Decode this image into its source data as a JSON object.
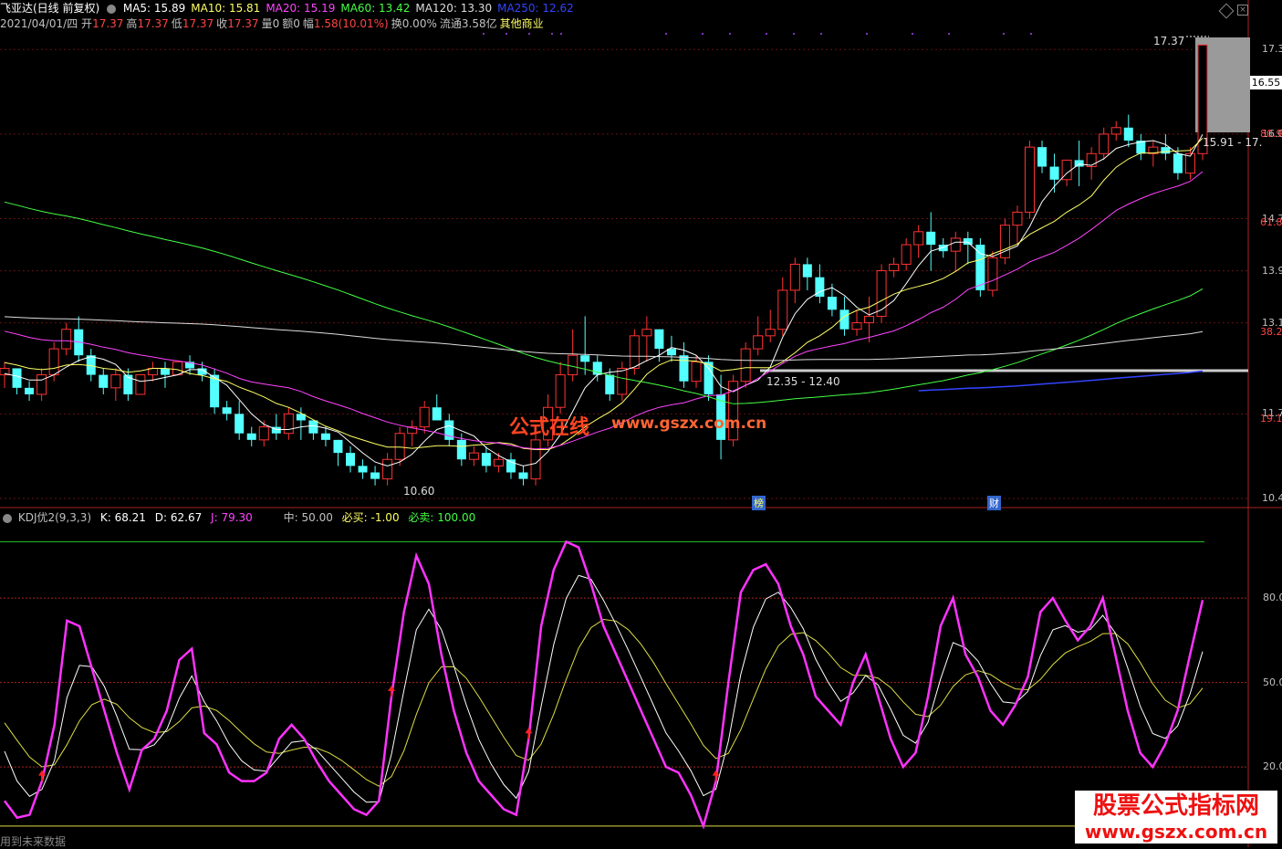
{
  "header": {
    "stock_name": "飞亚达(日线 前复权)",
    "ma": [
      {
        "label": "MA5: 15.89",
        "color": "#ffffff"
      },
      {
        "label": "MA10: 15.81",
        "color": "#ffff66"
      },
      {
        "label": "MA20: 15.19",
        "color": "#ff44ff"
      },
      {
        "label": "MA60: 13.42",
        "color": "#44ff44"
      },
      {
        "label": "MA120: 13.30",
        "color": "#dddddd"
      },
      {
        "label": "MA250: 12.62",
        "color": "#3344ff"
      }
    ],
    "date": "2021/04/01/四",
    "quote": [
      {
        "label": "开",
        "value": "17.37",
        "color": "#ff4444"
      },
      {
        "label": "高",
        "value": "17.37",
        "color": "#ff4444"
      },
      {
        "label": "低",
        "value": "17.37",
        "color": "#ff4444"
      },
      {
        "label": "收",
        "value": "17.37",
        "color": "#ff4444"
      },
      {
        "label": "量",
        "value": "0",
        "color": "#c0c0c0"
      },
      {
        "label": "额",
        "value": "0",
        "color": "#c0c0c0"
      },
      {
        "label": "幅",
        "value": "1.58(10.01%)",
        "color": "#ff4444"
      },
      {
        "label": "换",
        "value": "0.00%",
        "color": "#c0c0c0"
      },
      {
        "label": "流通",
        "value": "3.58亿",
        "color": "#c0c0c0"
      },
      {
        "label": "",
        "value": "其他商业",
        "color": "#ffff66"
      }
    ]
  },
  "price_axis_ticks": [
    "17.3",
    "16.0",
    "14.7",
    "13.9",
    "13.1",
    "11.7",
    "10.4"
  ],
  "right_pct_labels": [
    "80.9",
    "61.8",
    "38.2",
    "19.1"
  ],
  "last_price_box": "16.55",
  "annotations": {
    "high_label": "17.37",
    "low_label": "10.60",
    "range_label_1": "12.35 - 12.40",
    "range_label_2": "15.91 - 17.",
    "marker_1": "榜",
    "marker_2": "财"
  },
  "watermark": {
    "cn": "公式在线",
    "url": "www.gszx.com.cn"
  },
  "brand": {
    "line1": "股票公式指标网",
    "line2": "www.gszx.com.cn"
  },
  "indicator": {
    "name": "KDJ优2(9,3,3)",
    "k_label": "K: 68.21",
    "d_label": "D: 62.67",
    "j_label": "J: 79.30",
    "mid_label": "中: 50.00",
    "buy_label": "必买: -1.00",
    "sell_label": "必卖: 100.00",
    "axis_ticks": [
      "80.00",
      "50.00",
      "20.00"
    ]
  },
  "footer_note": "用到未来数据",
  "chart_data": {
    "type": "candlestick",
    "price_range": [
      10.4,
      17.5
    ],
    "candles": [
      [
        12.3,
        12.5,
        12.1,
        12.4
      ],
      [
        12.4,
        12.4,
        12.0,
        12.1
      ],
      [
        12.1,
        12.2,
        11.9,
        12.0
      ],
      [
        12.0,
        12.4,
        11.9,
        12.3
      ],
      [
        12.3,
        12.8,
        12.2,
        12.7
      ],
      [
        12.7,
        13.1,
        12.6,
        13.0
      ],
      [
        13.0,
        13.2,
        12.5,
        12.6
      ],
      [
        12.6,
        12.7,
        12.2,
        12.3
      ],
      [
        12.3,
        12.4,
        12.0,
        12.1
      ],
      [
        12.1,
        12.4,
        11.9,
        12.3
      ],
      [
        12.3,
        12.4,
        11.9,
        12.0
      ],
      [
        12.0,
        12.3,
        12.0,
        12.3
      ],
      [
        12.3,
        12.5,
        12.2,
        12.4
      ],
      [
        12.4,
        12.5,
        12.1,
        12.3
      ],
      [
        12.3,
        12.5,
        12.3,
        12.5
      ],
      [
        12.5,
        12.6,
        12.3,
        12.4
      ],
      [
        12.4,
        12.5,
        12.2,
        12.3
      ],
      [
        12.3,
        12.4,
        11.7,
        11.8
      ],
      [
        11.8,
        11.9,
        11.6,
        11.7
      ],
      [
        11.7,
        11.9,
        11.3,
        11.4
      ],
      [
        11.4,
        11.5,
        11.2,
        11.3
      ],
      [
        11.3,
        11.6,
        11.2,
        11.5
      ],
      [
        11.5,
        11.7,
        11.3,
        11.4
      ],
      [
        11.4,
        11.8,
        11.3,
        11.7
      ],
      [
        11.7,
        11.8,
        11.3,
        11.6
      ],
      [
        11.6,
        11.6,
        11.3,
        11.4
      ],
      [
        11.4,
        11.5,
        11.2,
        11.3
      ],
      [
        11.3,
        11.3,
        10.9,
        11.1
      ],
      [
        11.1,
        11.2,
        10.8,
        10.9
      ],
      [
        10.9,
        11.0,
        10.7,
        10.8
      ],
      [
        10.8,
        10.9,
        10.6,
        10.7
      ],
      [
        10.7,
        11.1,
        10.6,
        11.0
      ],
      [
        11.0,
        11.5,
        10.9,
        11.4
      ],
      [
        11.4,
        11.6,
        11.2,
        11.5
      ],
      [
        11.5,
        11.9,
        11.4,
        11.8
      ],
      [
        11.8,
        12.0,
        11.6,
        11.6
      ],
      [
        11.6,
        11.7,
        11.2,
        11.3
      ],
      [
        11.3,
        11.4,
        10.9,
        11.0
      ],
      [
        11.0,
        11.2,
        10.9,
        11.1
      ],
      [
        11.1,
        11.2,
        10.8,
        10.9
      ],
      [
        10.9,
        11.1,
        10.8,
        11.0
      ],
      [
        11.0,
        11.1,
        10.7,
        10.8
      ],
      [
        10.8,
        10.9,
        10.6,
        10.7
      ],
      [
        10.7,
        11.5,
        10.6,
        11.3
      ],
      [
        11.3,
        12.0,
        11.2,
        11.8
      ],
      [
        11.8,
        12.5,
        11.7,
        12.3
      ],
      [
        12.3,
        13.0,
        12.2,
        12.6
      ],
      [
        12.6,
        13.2,
        12.3,
        12.5
      ],
      [
        12.5,
        12.6,
        12.2,
        12.3
      ],
      [
        12.3,
        12.4,
        11.9,
        12.0
      ],
      [
        12.0,
        12.5,
        11.9,
        12.4
      ],
      [
        12.4,
        13.0,
        12.3,
        12.9
      ],
      [
        12.9,
        13.2,
        12.5,
        13.0
      ],
      [
        13.0,
        13.0,
        12.5,
        12.7
      ],
      [
        12.7,
        12.9,
        12.5,
        12.6
      ],
      [
        12.6,
        12.8,
        12.1,
        12.2
      ],
      [
        12.2,
        12.6,
        12.1,
        12.5
      ],
      [
        12.5,
        12.6,
        11.9,
        12.0
      ],
      [
        12.0,
        12.3,
        11.0,
        11.3
      ],
      [
        11.3,
        12.3,
        11.2,
        12.2
      ],
      [
        12.2,
        12.8,
        12.1,
        12.7
      ],
      [
        12.7,
        13.2,
        12.6,
        12.9
      ],
      [
        12.9,
        13.3,
        12.8,
        13.0
      ],
      [
        13.0,
        13.8,
        12.9,
        13.6
      ],
      [
        13.6,
        14.1,
        13.4,
        14.0
      ],
      [
        14.0,
        14.1,
        13.6,
        13.8
      ],
      [
        13.8,
        14.0,
        13.4,
        13.5
      ],
      [
        13.5,
        13.7,
        13.2,
        13.3
      ],
      [
        13.3,
        13.5,
        12.9,
        13.0
      ],
      [
        13.0,
        13.3,
        12.9,
        13.1
      ],
      [
        13.1,
        13.5,
        12.8,
        13.2
      ],
      [
        13.2,
        14.0,
        13.1,
        13.9
      ],
      [
        13.9,
        14.1,
        13.8,
        14.0
      ],
      [
        14.0,
        14.4,
        13.9,
        14.3
      ],
      [
        14.3,
        14.6,
        14.1,
        14.5
      ],
      [
        14.5,
        14.8,
        13.9,
        14.3
      ],
      [
        14.3,
        14.4,
        14.1,
        14.2
      ],
      [
        14.2,
        14.5,
        13.9,
        14.4
      ],
      [
        14.4,
        14.5,
        14.0,
        14.3
      ],
      [
        14.3,
        14.4,
        13.5,
        13.6
      ],
      [
        13.6,
        14.2,
        13.5,
        14.1
      ],
      [
        14.1,
        14.7,
        14.0,
        14.6
      ],
      [
        14.6,
        14.9,
        14.3,
        14.8
      ],
      [
        14.8,
        15.9,
        14.7,
        15.8
      ],
      [
        15.8,
        15.9,
        15.4,
        15.5
      ],
      [
        15.5,
        15.7,
        15.1,
        15.3
      ],
      [
        15.3,
        15.6,
        15.2,
        15.6
      ],
      [
        15.6,
        15.9,
        15.2,
        15.5
      ],
      [
        15.5,
        15.8,
        15.3,
        15.7
      ],
      [
        15.7,
        16.1,
        15.6,
        16.0
      ],
      [
        16.0,
        16.2,
        15.9,
        16.1
      ],
      [
        16.1,
        16.3,
        15.8,
        15.9
      ],
      [
        15.9,
        16.0,
        15.6,
        15.7
      ],
      [
        15.7,
        15.9,
        15.5,
        15.8
      ],
      [
        15.8,
        16.0,
        15.6,
        15.7
      ],
      [
        15.7,
        15.8,
        15.3,
        15.4
      ],
      [
        15.4,
        15.8,
        15.3,
        15.7
      ],
      [
        15.7,
        17.37,
        15.6,
        17.37
      ]
    ],
    "kdj_j": [
      8,
      2,
      3,
      15,
      35,
      72,
      70,
      55,
      40,
      25,
      12,
      26,
      30,
      40,
      58,
      62,
      32,
      28,
      18,
      15,
      15,
      18,
      30,
      35,
      30,
      22,
      15,
      10,
      5,
      3,
      8,
      45,
      75,
      95,
      85,
      60,
      40,
      25,
      15,
      10,
      5,
      3,
      30,
      70,
      90,
      100,
      98,
      85,
      70,
      60,
      50,
      40,
      30,
      20,
      18,
      10,
      -1,
      15,
      50,
      82,
      90,
      92,
      85,
      70,
      60,
      45,
      40,
      35,
      50,
      60,
      45,
      30,
      20,
      25,
      45,
      70,
      80,
      60,
      52,
      40,
      35,
      42,
      52,
      75,
      80,
      72,
      65,
      70,
      80,
      60,
      40,
      25,
      20,
      28,
      40,
      60,
      79.3
    ]
  }
}
